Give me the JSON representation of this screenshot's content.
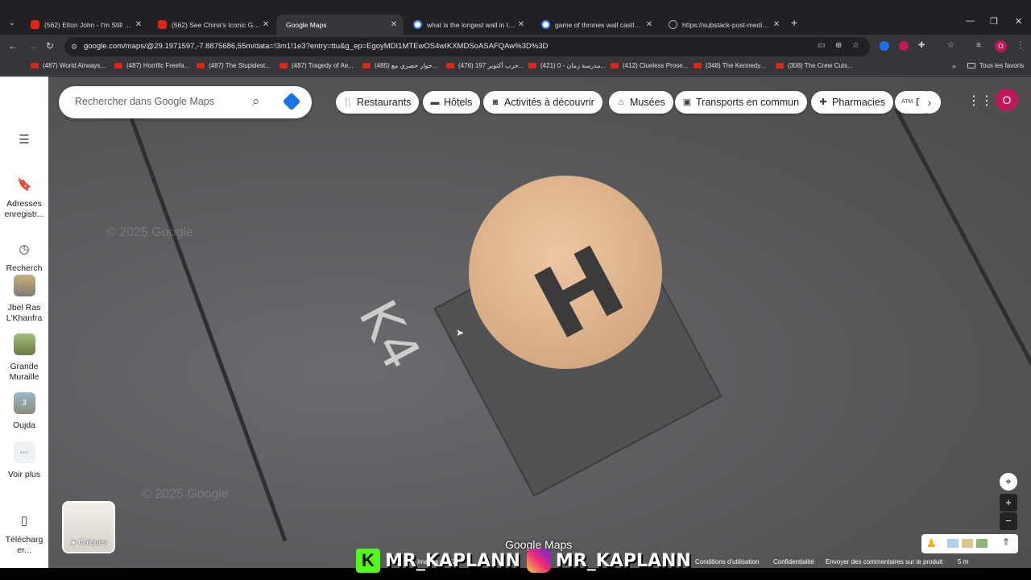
{
  "tabs": [
    {
      "title": "(562) Elton John - I'm Still Standing",
      "favicon": "youtube-icon",
      "active": false
    },
    {
      "title": "(562) See China's Iconic Great Wall",
      "favicon": "youtube-icon",
      "active": false
    },
    {
      "title": "Google Maps",
      "favicon": "maps-icon",
      "active": true
    },
    {
      "title": "what is the longest wall in the world",
      "favicon": "google-icon",
      "active": false
    },
    {
      "title": "game of thrones wall castles map",
      "favicon": "google-icon",
      "active": false
    },
    {
      "title": "https://substack-post-media.s3",
      "favicon": "web-icon",
      "active": false
    }
  ],
  "address": {
    "url": "google.com/maps/@29.1971597,-7.8875686,55m/data=!3m1!1e3?entry=ttu&g_ep=EgoyMDI1MTEwOS4wIKXMDSoASAFQAw%3D%3D"
  },
  "bookmarks": [
    "(487) World Airways...",
    "(487) Horrific Freefa...",
    "(487) The Stupidest...",
    "(487) Tragedy of Ae...",
    "(485) حوار حصري مع...",
    "(476) حرب أكتوبر 197...",
    "(421) مدرسة زمان - 0...",
    "(412) Clueless Prose...",
    "(348) The Kennedy...",
    "(308) The Crew Cuts..."
  ],
  "bookmarks_other": "Tous les favoris",
  "rail": {
    "saved": "Adresses enregistr...",
    "recent": "Recherch es...",
    "places": [
      "Jbel Ras L'Khanfra",
      "Grande Muraille",
      "Oujda"
    ],
    "oujda_badge": "3",
    "more": "Voir plus",
    "download": "Télécharg er..."
  },
  "search": {
    "placeholder": "Rechercher dans Google Maps"
  },
  "chips": [
    {
      "label": "Restaurants",
      "icon": "restaurant-icon"
    },
    {
      "label": "Hôtels",
      "icon": "bed-icon"
    },
    {
      "label": "Activités à découvrir",
      "icon": "camera-icon"
    },
    {
      "label": "Musées",
      "icon": "museum-icon"
    },
    {
      "label": "Transports en commun",
      "icon": "bus-icon"
    },
    {
      "label": "Pharmacies",
      "icon": "pharmacy-icon"
    },
    {
      "label": "D...",
      "icon": "atm-icon"
    }
  ],
  "account_initial": "O",
  "layers_label": "Calques",
  "map": {
    "brand": "Google Maps",
    "pad_letter": "H",
    "ground_text": "K4",
    "watermark": "© 2025 Google",
    "scale": "5 m"
  },
  "footer": [
    "Images ©2025",
    "Conditions d'utilisation",
    "Confidentialité",
    "Envoyer des commentaires sur le produit"
  ],
  "overlay": {
    "kick_name": "MR_KAPLANN",
    "instagram_name": "MR_KAPLANN",
    "kick_letter": "K"
  }
}
